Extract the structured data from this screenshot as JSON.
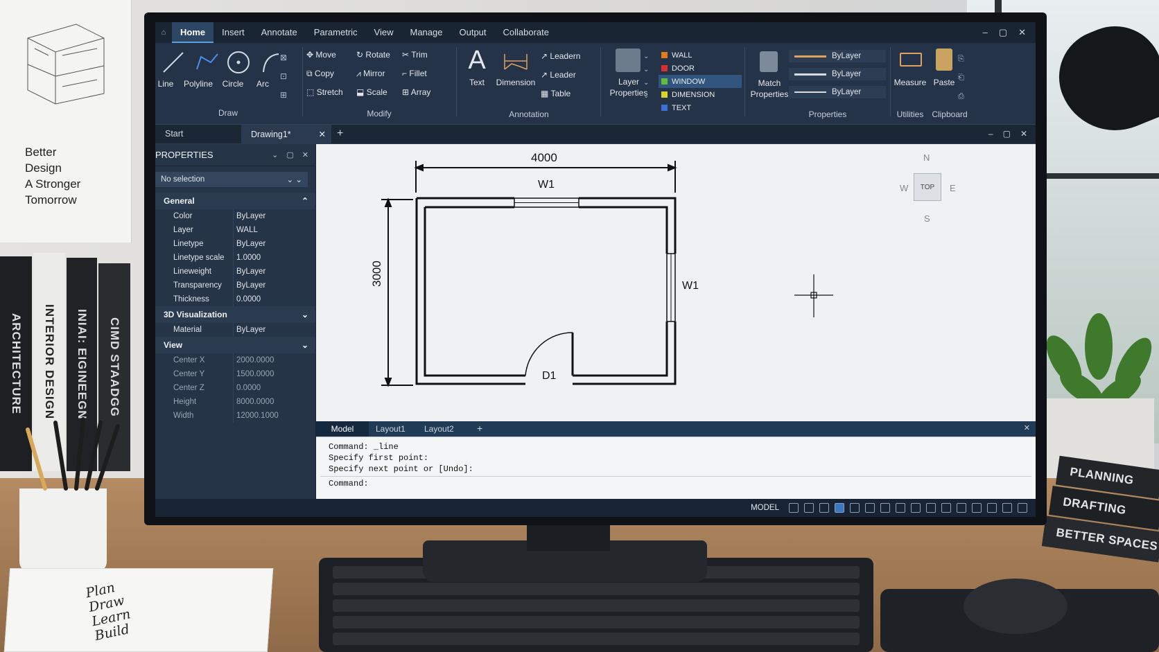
{
  "poster": {
    "text": "Better\nDesign\nA Stronger\nTomorrow"
  },
  "books_left": [
    "ARCHITECTURE",
    "INTERIOR DESIGN",
    "INIAI: EIGINEEGN",
    "CIMD STAADGG"
  ],
  "books_right": [
    "PLANNING",
    "DRAFTING",
    "BETTER SPACES"
  ],
  "notebook": {
    "text": "Plan\nDraw\nLearn\nBuild"
  },
  "menu": {
    "tabs": [
      "Home",
      "Insert",
      "Annotate",
      "Parametric",
      "View",
      "Manage",
      "Output",
      "Collaborate"
    ],
    "active": "Home"
  },
  "ribbon": {
    "draw": {
      "title": "Draw",
      "line": "Line",
      "polyline": "Polyline",
      "circle": "Circle",
      "arc": "Arc"
    },
    "modify": {
      "title": "Modify",
      "move": "Move",
      "rotate": "Rotate",
      "trim": "Trim",
      "copy": "Copy",
      "mirror": "Mirror",
      "fillet": "Fillet",
      "stretch": "Stretch",
      "scale": "Scale",
      "array": "Array"
    },
    "annotation": {
      "title": "Annotation",
      "text": "Text",
      "dimension": "Dimension",
      "leadern": "Leadern",
      "leader": "Leader",
      "table": "Table"
    },
    "layers": {
      "layer_properties": "Layer\nProperties",
      "items": [
        {
          "name": "WALL",
          "color": "#e07a1c"
        },
        {
          "name": "DOOR",
          "color": "#d83030"
        },
        {
          "name": "WINDOW",
          "color": "#5fbf3c"
        },
        {
          "name": "DIMENSION",
          "color": "#d8d42a"
        },
        {
          "name": "TEXT",
          "color": "#3d6fd8"
        }
      ]
    },
    "properties": {
      "title": "Properties",
      "match": "Match\nProperties",
      "bylayer1": "ByLayer",
      "bylayer2": "ByLayer",
      "bylayer3": "ByLayer"
    },
    "utilities": {
      "title": "Utilities",
      "measure": "Measure"
    },
    "clipboard": {
      "title": "Clipboard",
      "paste": "Paste"
    }
  },
  "doctabs": {
    "start": "Start",
    "drawing": "Drawing1*"
  },
  "properties_panel": {
    "title": "PROPERTIES",
    "selection": "No selection",
    "general": {
      "title": "General",
      "rows": [
        {
          "k": "Color",
          "v": "ByLayer"
        },
        {
          "k": "Layer",
          "v": "WALL"
        },
        {
          "k": "Linetype",
          "v": "ByLayer"
        },
        {
          "k": "Linetype scale",
          "v": "1.0000"
        },
        {
          "k": "Lineweight",
          "v": "ByLayer"
        },
        {
          "k": "Transparency",
          "v": "ByLayer"
        },
        {
          "k": "Thickness",
          "v": "0.0000"
        }
      ]
    },
    "viz": {
      "title": "3D Visualization",
      "rows": [
        {
          "k": "Material",
          "v": "ByLayer"
        }
      ]
    },
    "view": {
      "title": "View",
      "rows": [
        {
          "k": "Center X",
          "v": "2000.0000"
        },
        {
          "k": "Center Y",
          "v": "1500.0000"
        },
        {
          "k": "Center Z",
          "v": "0.0000"
        },
        {
          "k": "Height",
          "v": "8000.0000"
        },
        {
          "k": "Width",
          "v": "12000.1000"
        }
      ]
    }
  },
  "drawing": {
    "dim_width": "4000",
    "dim_height": "3000",
    "window_top": "W1",
    "window_right": "W1",
    "door": "D1"
  },
  "viewcube": {
    "n": "N",
    "s": "S",
    "e": "E",
    "w": "W",
    "top": "TOP"
  },
  "layout_tabs": {
    "model": "Model",
    "layout1": "Layout1",
    "layout2": "Layout2"
  },
  "command": {
    "lines": [
      "Command: _line",
      "Specify first point:",
      "Specify next point or [Undo]:"
    ],
    "prompt": "Command:"
  },
  "status": {
    "model": "MODEL"
  }
}
